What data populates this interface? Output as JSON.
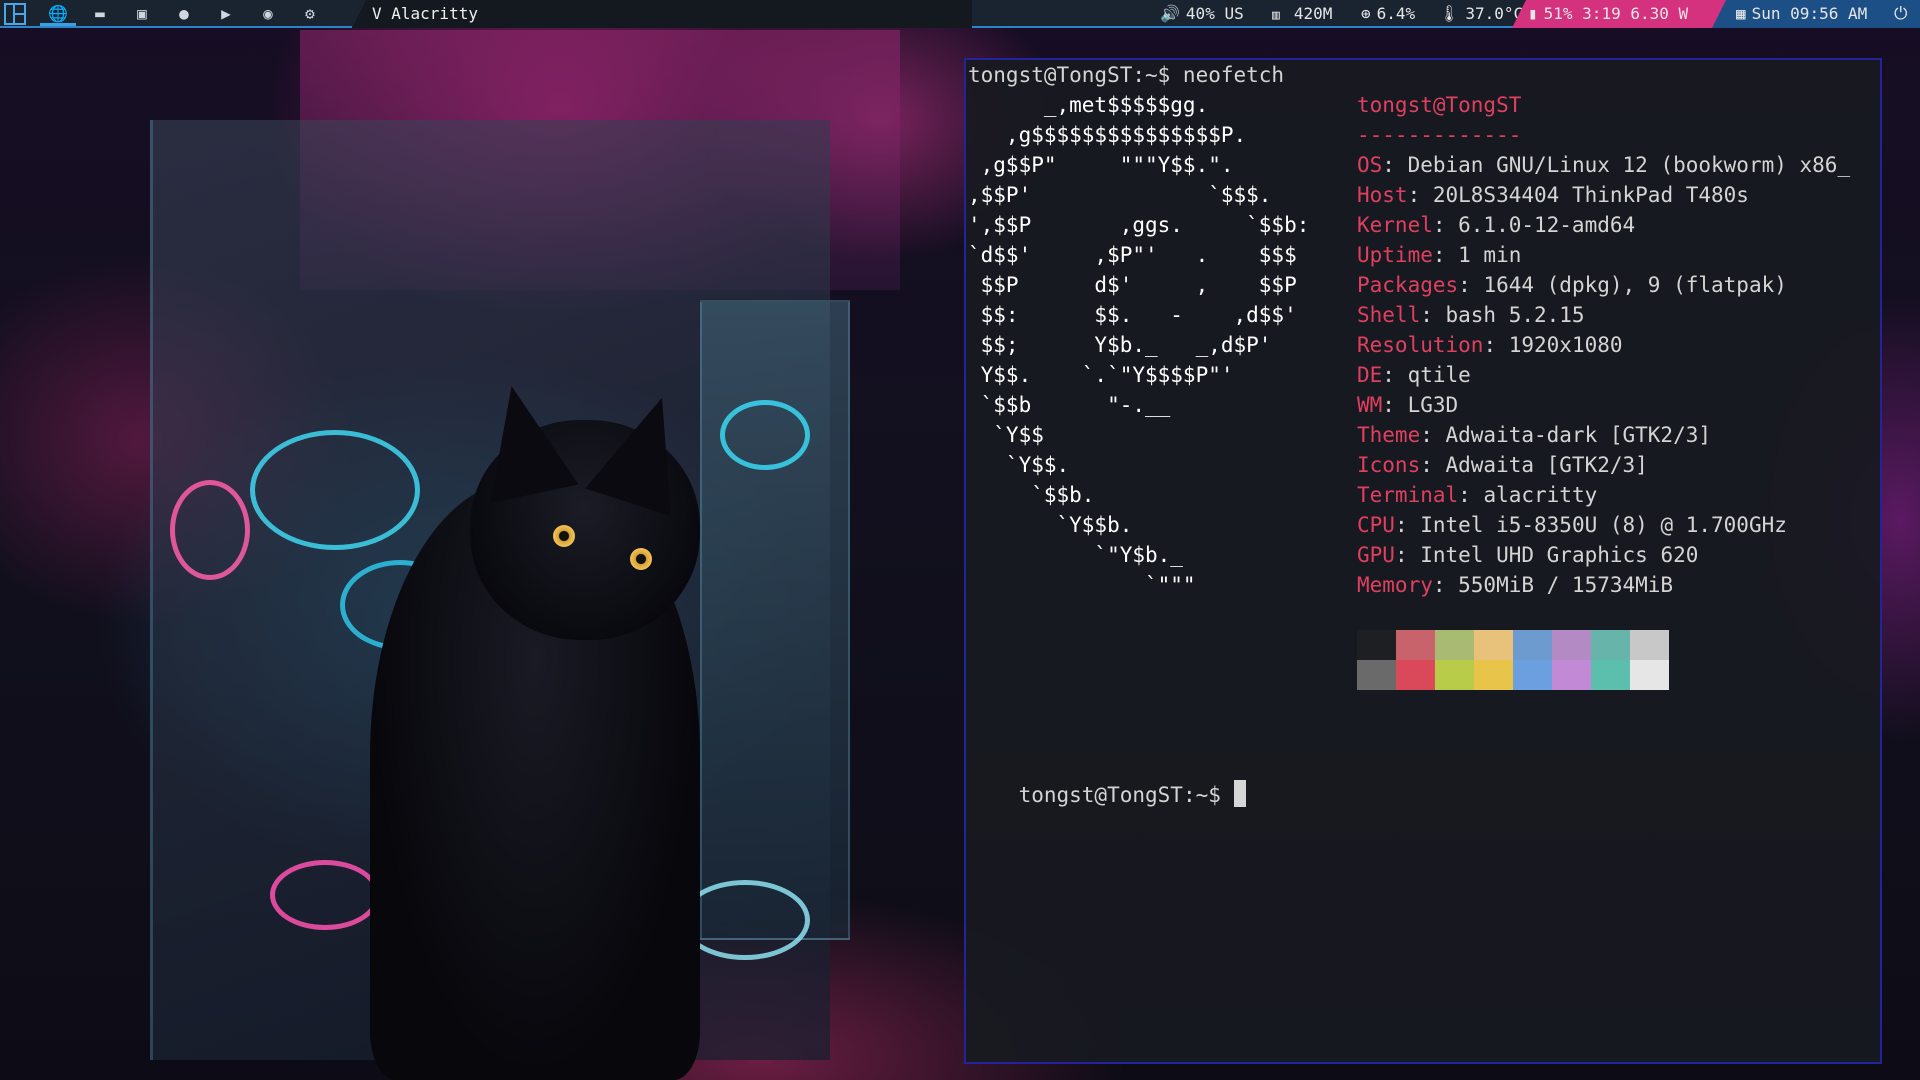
{
  "topbar": {
    "workspaces": [
      {
        "icon": "globe-icon",
        "glyph": "🌐",
        "active": true
      },
      {
        "icon": "folder-icon",
        "glyph": "▬",
        "active": false
      },
      {
        "icon": "terminal-icon",
        "glyph": "▣",
        "active": false
      },
      {
        "icon": "chat-icon",
        "glyph": "●",
        "active": false
      },
      {
        "icon": "video-icon",
        "glyph": "▶",
        "active": false
      },
      {
        "icon": "gamepad-icon",
        "glyph": "◉",
        "active": false
      },
      {
        "icon": "gear-icon",
        "glyph": "⚙",
        "active": false
      }
    ],
    "window_title": "V Alacritty",
    "volume": "40% US",
    "memory": "420M",
    "cpu": "6.4%",
    "temperature": "37.0°C",
    "battery": "51% 3:19 6.30 W",
    "clock": "Sun 09:56 AM",
    "colors": {
      "bar_bg": "#1a2330",
      "accent": "#2b84c9",
      "battery_bg": "#d4317f",
      "clock_bg": "#1c4f86"
    }
  },
  "terminal": {
    "prompt_command": "tongst@TongST:~$ neofetch",
    "ascii_art": [
      "      _,met$$$$$gg.",
      "   ,g$$$$$$$$$$$$$$$P.",
      " ,g$$P\"     \"\"\"Y$$.\".",
      ",$$P'              `$$$.",
      "',$$P       ,ggs.     `$$b:",
      "`d$$'     ,$P\"'   .    $$$",
      " $$P      d$'     ,    $$P",
      " $$:      $$.   -    ,d$$'",
      " $$;      Y$b._   _,d$P'",
      " Y$$.    `.`\"Y$$$$P\"'",
      " `$$b      \"-.__",
      "  `Y$$",
      "   `Y$$.",
      "     `$$b.",
      "       `Y$$b.",
      "          `\"Y$b._",
      "              `\"\"\""
    ],
    "user_host": "tongst@TongST",
    "separator": "-------------",
    "info": [
      {
        "key": "OS",
        "value": ": Debian GNU/Linux 12 (bookworm) x86_"
      },
      {
        "key": "Host",
        "value": ": 20L8S34404 ThinkPad T480s"
      },
      {
        "key": "Kernel",
        "value": ": 6.1.0-12-amd64"
      },
      {
        "key": "Uptime",
        "value": ": 1 min"
      },
      {
        "key": "Packages",
        "value": ": 1644 (dpkg), 9 (flatpak)"
      },
      {
        "key": "Shell",
        "value": ": bash 5.2.15"
      },
      {
        "key": "Resolution",
        "value": ": 1920x1080"
      },
      {
        "key": "DE",
        "value": ": qtile"
      },
      {
        "key": "WM",
        "value": ": LG3D"
      },
      {
        "key": "Theme",
        "value": ": Adwaita-dark [GTK2/3]"
      },
      {
        "key": "Icons",
        "value": ": Adwaita [GTK2/3]"
      },
      {
        "key": "Terminal",
        "value": ": alacritty"
      },
      {
        "key": "CPU",
        "value": ": Intel i5-8350U (8) @ 1.700GHz"
      },
      {
        "key": "GPU",
        "value": ": Intel UHD Graphics 620"
      },
      {
        "key": "Memory",
        "value": ": 550MiB / 15734MiB"
      }
    ],
    "palette_top": [
      "#1d1f23",
      "#c9636b",
      "#a9bb72",
      "#e8c27a",
      "#6d9bcf",
      "#b48ac4",
      "#67b5aa",
      "#c8c8c8"
    ],
    "palette_bottom": [
      "#6a6a6a",
      "#d9495a",
      "#b9cc4a",
      "#e9c44a",
      "#6c9fe0",
      "#c28ad6",
      "#5cbfae",
      "#e6e6e6"
    ],
    "prompt": "tongst@TongST:~$ "
  }
}
